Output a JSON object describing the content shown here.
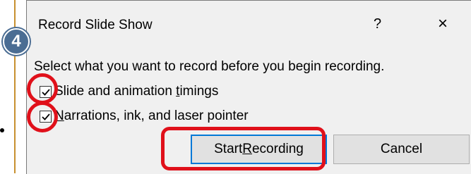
{
  "dialog": {
    "title": "Record Slide Show",
    "help_label": "?",
    "close_label": "×",
    "instruction": "Select what you want to record before you begin recording.",
    "options": [
      {
        "pre": "Slide and animation ",
        "mnemonic": "t",
        "post": "imings",
        "checked": true
      },
      {
        "pre": "",
        "mnemonic": "N",
        "post": "arrations, ink, and laser pointer",
        "checked": true
      }
    ],
    "start_button": {
      "pre": "Start ",
      "mnemonic": "R",
      "post": "ecording"
    },
    "cancel_label": "Cancel"
  },
  "annotation": {
    "step_number": "4",
    "highlight_color": "#e0101a",
    "badge_color": "#4b6d93"
  }
}
